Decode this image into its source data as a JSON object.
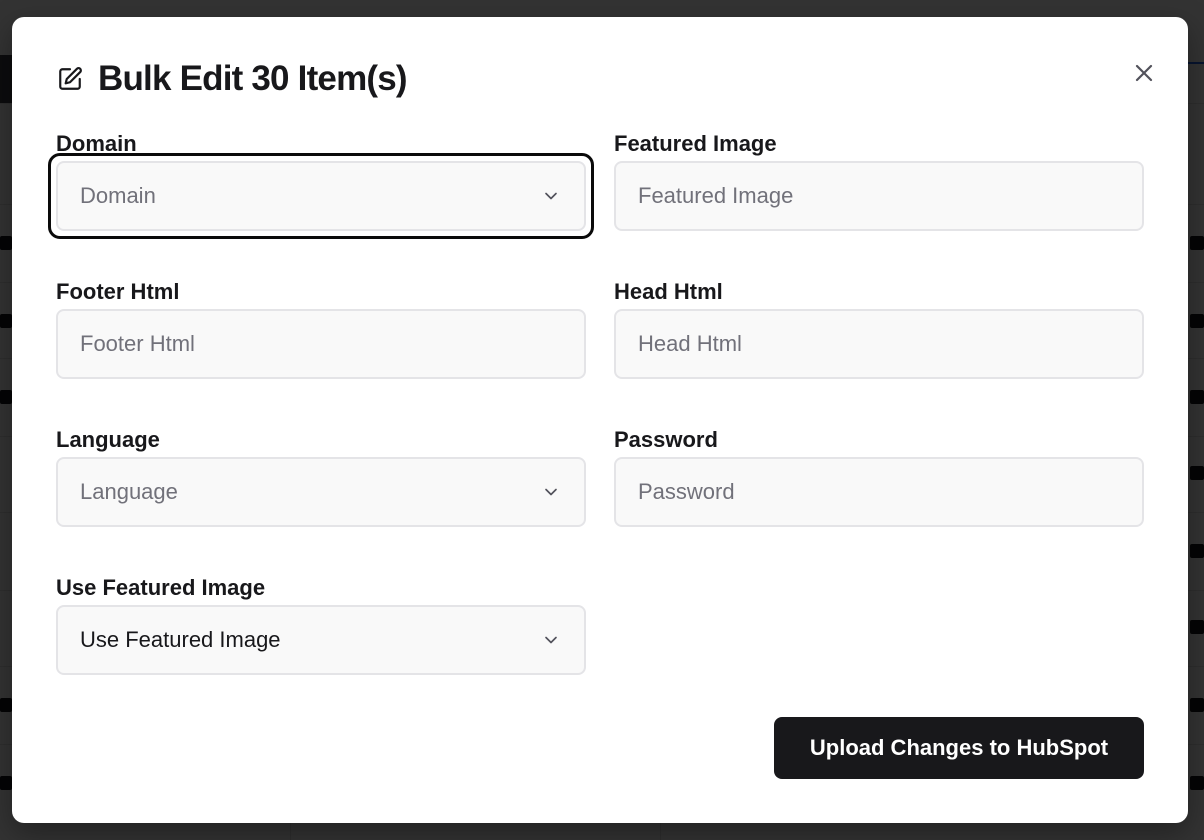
{
  "modal": {
    "title": "Bulk Edit 30 Item(s)",
    "icons": {
      "title_icon": "pencil-square-icon",
      "close_icon": "close-icon"
    }
  },
  "fields": {
    "domain": {
      "label": "Domain",
      "placeholder": "Domain",
      "type": "select",
      "focused": true
    },
    "featured_image": {
      "label": "Featured Image",
      "placeholder": "Featured Image",
      "type": "text"
    },
    "footer_html": {
      "label": "Footer Html",
      "placeholder": "Footer Html",
      "type": "text"
    },
    "head_html": {
      "label": "Head Html",
      "placeholder": "Head Html",
      "type": "text"
    },
    "language": {
      "label": "Language",
      "placeholder": "Language",
      "type": "select"
    },
    "password": {
      "label": "Password",
      "placeholder": "Password",
      "type": "text"
    },
    "use_featured_image": {
      "label": "Use Featured Image",
      "value": "Use Featured Image",
      "type": "select"
    }
  },
  "actions": {
    "upload_label": "Upload Changes to HubSpot"
  },
  "colors": {
    "primary": "#18181b",
    "field_background": "#f9f9f9",
    "field_border": "#e4e4e7",
    "placeholder_text": "#71717a",
    "overlay": "rgba(0,0,0,0.8)"
  }
}
